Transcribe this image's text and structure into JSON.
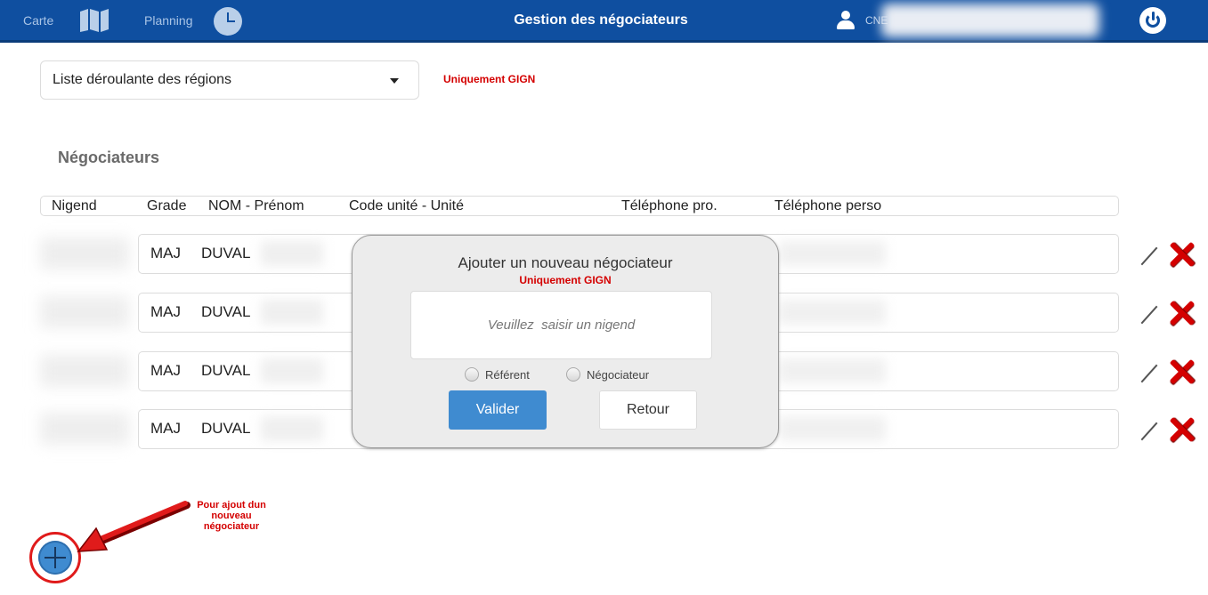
{
  "nav": {
    "carte_label": "Carte",
    "planning_label": "Planning",
    "title": "Gestion des négociateurs",
    "user_prefix": "CNE"
  },
  "filter": {
    "region_select_value": "Liste déroulante des régions",
    "note": "Uniquement GIGN"
  },
  "section_title": "Négociateurs",
  "table": {
    "columns": [
      "Nigend",
      "Grade",
      "NOM - Prénom",
      "Code unité - Unité",
      "Téléphone pro.",
      "Téléphone perso"
    ],
    "rows": [
      {
        "grade": "MAJ",
        "nom": "DUVAL"
      },
      {
        "grade": "MAJ",
        "nom": "DUVAL"
      },
      {
        "grade": "MAJ",
        "nom": "DUVAL"
      },
      {
        "grade": "MAJ",
        "nom": "DUVAL"
      }
    ]
  },
  "modal": {
    "title": "Ajouter un nouveau négociateur",
    "subtitle": "Uniquement GIGN",
    "input_placeholder": "Veuillez  saisir un nigend",
    "radio_referent": "Référent",
    "radio_negociateur": "Négociateur",
    "validate_label": "Valider",
    "back_label": "Retour"
  },
  "annotation": {
    "line1": "Pour ajout dun",
    "line2": "nouveau",
    "line3": "négociateur"
  },
  "colors": {
    "nav_bg": "#0f4fa0",
    "accent_blue": "#3f8bd0",
    "alert_red": "#d40000"
  },
  "icons": [
    "map-icon",
    "clock-icon",
    "user-icon",
    "power-icon",
    "caret-down-icon",
    "edit-icon",
    "delete-icon",
    "add-icon",
    "arrow-icon"
  ]
}
